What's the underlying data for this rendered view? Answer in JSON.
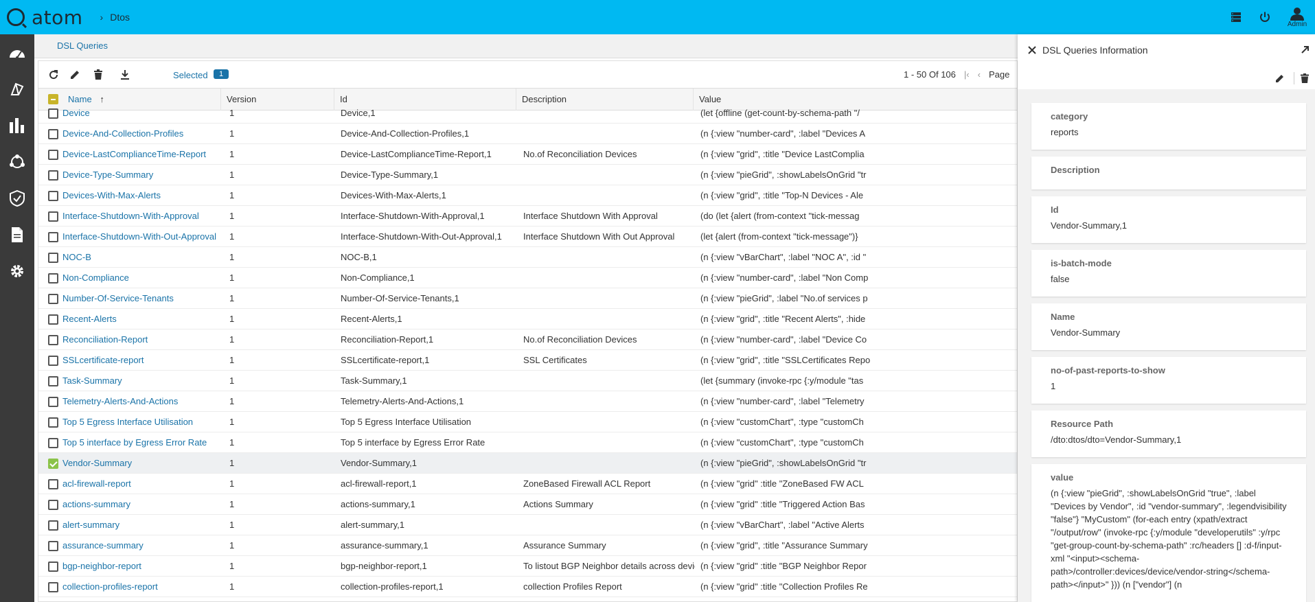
{
  "app": {
    "logo_text": "atom",
    "breadcrumb_sep": "›",
    "breadcrumb": "Dtos",
    "admin_label": "Admin"
  },
  "subheader": {
    "title": "DSL Queries"
  },
  "toolbar": {
    "selected_label": "Selected",
    "selected_count": "1"
  },
  "pager": {
    "range": "1 - 50 Of 106",
    "page_label": "Page"
  },
  "columns": {
    "name": "Name",
    "version": "Version",
    "id": "Id",
    "description": "Description",
    "value": "Value"
  },
  "rows": [
    {
      "name": "Device",
      "version": "1",
      "id": "Device,1",
      "description": "",
      "value": "(let {offline (get-count-by-schema-path \"/",
      "checked": false
    },
    {
      "name": "Device-And-Collection-Profiles",
      "version": "1",
      "id": "Device-And-Collection-Profiles,1",
      "description": "",
      "value": "(n {:view \"number-card\", :label \"Devices A",
      "checked": false
    },
    {
      "name": "Device-LastComplianceTime-Report",
      "version": "1",
      "id": "Device-LastComplianceTime-Report,1",
      "description": "No.of Reconciliation Devices",
      "value": "(n {:view \"grid\", :title \"Device LastComplia",
      "checked": false
    },
    {
      "name": "Device-Type-Summary",
      "version": "1",
      "id": "Device-Type-Summary,1",
      "description": "",
      "value": "(n {:view \"pieGrid\", :showLabelsOnGrid \"tr",
      "checked": false
    },
    {
      "name": "Devices-With-Max-Alerts",
      "version": "1",
      "id": "Devices-With-Max-Alerts,1",
      "description": "",
      "value": "(n {:view \"grid\", :title \"Top-N Devices - Ale",
      "checked": false
    },
    {
      "name": "Interface-Shutdown-With-Approval",
      "version": "1",
      "id": "Interface-Shutdown-With-Approval,1",
      "description": "Interface Shutdown With Approval",
      "value": "(do (let {alert (from-context \"tick-messag",
      "checked": false
    },
    {
      "name": "Interface-Shutdown-With-Out-Approval",
      "version": "1",
      "id": "Interface-Shutdown-With-Out-Approval,1",
      "description": "Interface Shutdown With Out Approval",
      "value": "(let {alert (from-context \"tick-message\")}",
      "checked": false
    },
    {
      "name": "NOC-B",
      "version": "1",
      "id": "NOC-B,1",
      "description": "",
      "value": "(n {:view \"vBarChart\", :label \"NOC A\", :id \"",
      "checked": false
    },
    {
      "name": "Non-Compliance",
      "version": "1",
      "id": "Non-Compliance,1",
      "description": "",
      "value": "(n {:view \"number-card\", :label \"Non Comp",
      "checked": false
    },
    {
      "name": "Number-Of-Service-Tenants",
      "version": "1",
      "id": "Number-Of-Service-Tenants,1",
      "description": "",
      "value": "(n {:view \"pieGrid\", :label \"No.of services p",
      "checked": false
    },
    {
      "name": "Recent-Alerts",
      "version": "1",
      "id": "Recent-Alerts,1",
      "description": "",
      "value": "(n {:view \"grid\", :title \"Recent Alerts\", :hide",
      "checked": false
    },
    {
      "name": "Reconciliation-Report",
      "version": "1",
      "id": "Reconciliation-Report,1",
      "description": "No.of Reconciliation Devices",
      "value": "(n {:view \"number-card\", :label \"Device Co",
      "checked": false
    },
    {
      "name": "SSLcertificate-report",
      "version": "1",
      "id": "SSLcertificate-report,1",
      "description": "SSL Certificates",
      "value": "(n {:view \"grid\", :title \"SSLCertificates Repo",
      "checked": false
    },
    {
      "name": "Task-Summary",
      "version": "1",
      "id": "Task-Summary,1",
      "description": "",
      "value": "(let {summary (invoke-rpc {:y/module \"tas",
      "checked": false
    },
    {
      "name": "Telemetry-Alerts-And-Actions",
      "version": "1",
      "id": "Telemetry-Alerts-And-Actions,1",
      "description": "",
      "value": "(n {:view \"number-card\", :label \"Telemetry",
      "checked": false
    },
    {
      "name": "Top 5 Egress Interface Utilisation",
      "version": "1",
      "id": "Top 5 Egress Interface Utilisation",
      "description": "",
      "value": "(n {:view \"customChart\", :type \"customCh",
      "checked": false
    },
    {
      "name": "Top 5 interface by Egress Error Rate",
      "version": "1",
      "id": "Top 5 interface by Egress Error Rate",
      "description": "",
      "value": "(n {:view \"customChart\", :type \"customCh",
      "checked": false
    },
    {
      "name": "Vendor-Summary",
      "version": "1",
      "id": "Vendor-Summary,1",
      "description": "",
      "value": "(n {:view \"pieGrid\", :showLabelsOnGrid \"tr",
      "checked": true
    },
    {
      "name": "acl-firewall-report",
      "version": "1",
      "id": "acl-firewall-report,1",
      "description": "ZoneBased Firewall ACL Report",
      "value": "(n {:view \"grid\" :title \"ZoneBased FW ACL",
      "checked": false
    },
    {
      "name": "actions-summary",
      "version": "1",
      "id": "actions-summary,1",
      "description": "Actions Summary",
      "value": "(n {:view \"grid\" :title \"Triggered Action Bas",
      "checked": false
    },
    {
      "name": "alert-summary",
      "version": "1",
      "id": "alert-summary,1",
      "description": "",
      "value": "(n {:view \"vBarChart\", :label \"Active Alerts",
      "checked": false
    },
    {
      "name": "assurance-summary",
      "version": "1",
      "id": "assurance-summary,1",
      "description": "Assurance Summary",
      "value": "(n {:view \"grid\", :title \"Assurance Summary",
      "checked": false
    },
    {
      "name": "bgp-neighbor-report",
      "version": "1",
      "id": "bgp-neighbor-report,1",
      "description": "To listout BGP Neighbor details across devices",
      "value": "(n {:view \"grid\" :title \"BGP Neighbor Repor",
      "checked": false
    },
    {
      "name": "collection-profiles-report",
      "version": "1",
      "id": "collection-profiles-report,1",
      "description": "collection Profiles Report",
      "value": "(n {:view \"grid\" :title \"Collection Profiles Re",
      "checked": false
    }
  ],
  "panel": {
    "title": "DSL Queries Information",
    "fields": [
      {
        "key": "category",
        "value": "reports"
      },
      {
        "key": "Description",
        "value": ""
      },
      {
        "key": "Id",
        "value": "Vendor-Summary,1"
      },
      {
        "key": "is-batch-mode",
        "value": "false"
      },
      {
        "key": "Name",
        "value": "Vendor-Summary"
      },
      {
        "key": "no-of-past-reports-to-show",
        "value": "1"
      },
      {
        "key": "Resource Path",
        "value": "/dto:dtos/dto=Vendor-Summary,1"
      },
      {
        "key": "value",
        "value": "(n {:view \"pieGrid\", :showLabelsOnGrid \"true\", :label \"Devices by Vendor\", :id \"vendor-summary\", :legendvisibility \"false\"} \"MyCustom\" (for-each entry (xpath/extract \"/output/row\" (invoke-rpc {:y/module \"developerutils\" :y/rpc \"get-group-count-by-schema-path\" :rc/headers [] :d-f/input-xml \"<input><schema-path>/controller:devices/device/vendor-string</schema-path></input>\" })) (n [\"vendor\"] (n"
      }
    ]
  },
  "colors": {
    "topbar": "#00b9f2",
    "leftnav": "#3a3a3a",
    "link": "#1a73a8",
    "checkbox_checked": "#8bc34a",
    "checkbox_indeterminate": "#c8b42a"
  }
}
